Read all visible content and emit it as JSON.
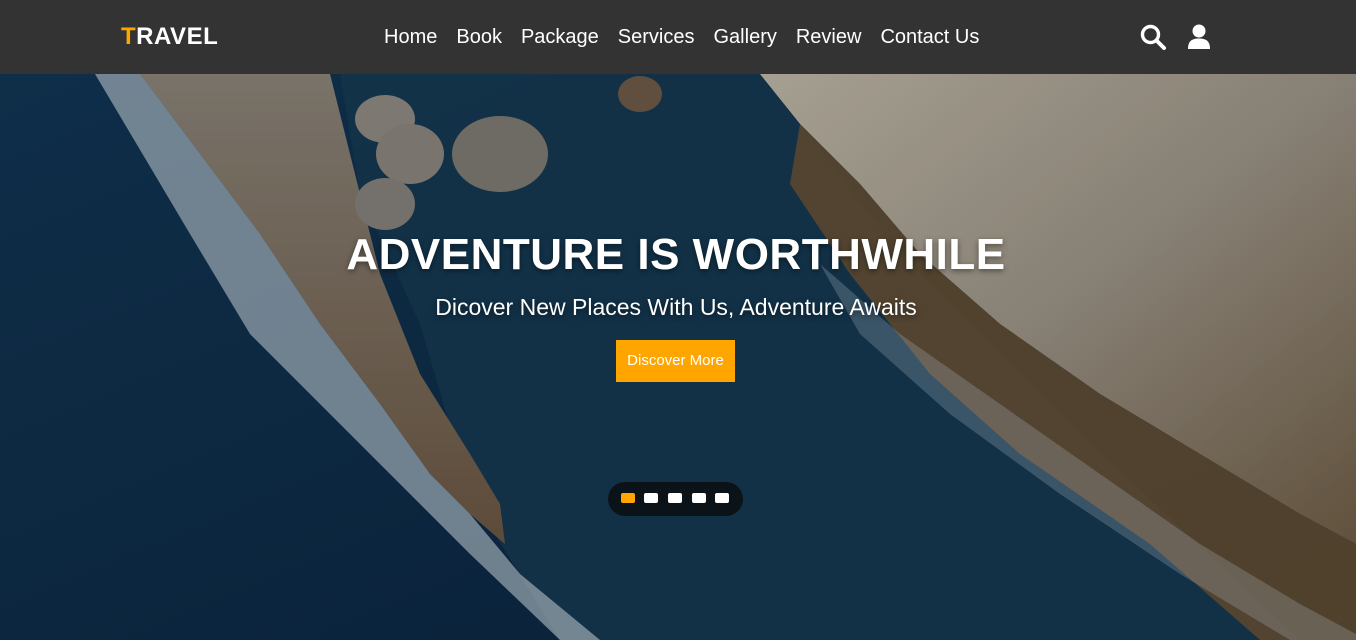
{
  "header": {
    "logo_first": "T",
    "logo_rest": "RAVEL",
    "nav": [
      "Home",
      "Book",
      "Package",
      "Services",
      "Gallery",
      "Review",
      "Contact Us"
    ],
    "search_icon": "search-icon",
    "user_icon": "user-icon"
  },
  "hero": {
    "title": "ADVENTURE IS WORTHWHILE",
    "subtitle": "Dicover New Places With Us, Adventure Awaits",
    "button_label": "Discover More",
    "slides": 5,
    "active_slide": 1
  },
  "colors": {
    "accent": "#ffa500",
    "header_bg": "#333333",
    "text": "#ffffff"
  }
}
